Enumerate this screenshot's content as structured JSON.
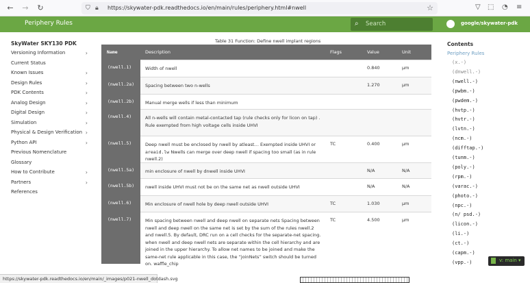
{
  "browser": {
    "url": "https://skywater-pdk.readthedocs.io/en/main/rules/periphery.html#nwell"
  },
  "header": {
    "title": "Periphery Rules",
    "search_placeholder": "Search",
    "repo_link": "google/skywater-pdk"
  },
  "left_nav": {
    "title": "SkyWater SKY130 PDK",
    "items": [
      {
        "label": "Versioning Information",
        "expandable": true
      },
      {
        "label": "Current Status",
        "expandable": false
      },
      {
        "label": "Known Issues",
        "expandable": true
      },
      {
        "label": "Design Rules",
        "expandable": true
      },
      {
        "label": "PDK Contents",
        "expandable": true
      },
      {
        "label": "Analog Design",
        "expandable": true
      },
      {
        "label": "Digital Design",
        "expandable": true
      },
      {
        "label": "Simulation",
        "expandable": true
      },
      {
        "label": "Physical & Design Verification",
        "expandable": true
      },
      {
        "label": "Python API",
        "expandable": true
      },
      {
        "label": "Previous Nomenclature",
        "expandable": false
      },
      {
        "label": "Glossary",
        "expandable": false
      },
      {
        "label": "How to Contribute",
        "expandable": true
      },
      {
        "label": "Partners",
        "expandable": true
      },
      {
        "label": "References",
        "expandable": false
      }
    ]
  },
  "table": {
    "caption": "Table 31 Function: Define nwell implant regions",
    "headers": {
      "name": "Name",
      "description": "Description",
      "flags": "Flags",
      "value": "Value",
      "unit": "Unit"
    },
    "rows": [
      {
        "name": "(nwell.1)",
        "desc": "Width of nwell",
        "desc_mono": "",
        "desc_after": "",
        "flags": "",
        "value": "0.840",
        "unit": "µm"
      },
      {
        "name": "(nwell.2a)",
        "desc": "Spacing between two n-wells",
        "desc_mono": "",
        "desc_after": "",
        "flags": "",
        "value": "1.270",
        "unit": "µm"
      },
      {
        "name": "(nwell.2b)",
        "desc": "Manual merge wells if less than minimum",
        "desc_mono": "",
        "desc_after": "",
        "flags": "",
        "value": "",
        "unit": ""
      },
      {
        "name": "(nwell.4)",
        "desc": "All n-wells will contain metal-contacted tap (rule checks only for licon on tap) . Rule exempted from high voltage cells inside UHVI",
        "desc_mono": "",
        "desc_after": "",
        "flags": "",
        "value": "",
        "unit": ""
      },
      {
        "name": "(nwell.5)",
        "desc": "Deep nwell must be enclosed by nwell by atleast… Exempted inside UHVI or",
        "desc_mono": "areaid.lw",
        "desc_after": "Nwells can merge over deep nwell if spacing too small (as in rule nwell.2)",
        "flags": "TC",
        "value": "0.400",
        "unit": "µm"
      },
      {
        "name": "(nwell.5a)",
        "desc": "min enclosure of nwell by dnwell inside UHVI",
        "desc_mono": "",
        "desc_after": "",
        "flags": "",
        "value": "N/A",
        "unit": "N/A"
      },
      {
        "name": "(nwell.5b)",
        "desc": "nwell inside UHVI must not be on the same net as nwell outside UHVI",
        "desc_mono": "",
        "desc_after": "",
        "flags": "",
        "value": "N/A",
        "unit": "N/A"
      },
      {
        "name": "(nwell.6)",
        "desc": "Min enclosure of nwell hole by deep nwell outside UHVI",
        "desc_mono": "",
        "desc_after": "",
        "flags": "TC",
        "value": "1.030",
        "unit": "µm"
      },
      {
        "name": "(nwell.7)",
        "desc": "Min spacing between nwell and deep nwell on separate nets Spacing between nwell and deep nwell on the same net is set by the sum of the rules nwell.2 and nwell.5. By default, DRC run on a cell checks for the separate-net spacing. when nwell and deep nwell nets are separate within the cell hierarchy and are joined in the upper hierarchy. To allow net names to be joined and make the same-net rule applicable in this case, the “joinNets” switch should be turned on. waffle_chip",
        "desc_mono": "",
        "desc_after": "",
        "flags": "TC",
        "value": "4.500",
        "unit": "µm"
      }
    ]
  },
  "toc": {
    "title": "Contents",
    "subtitle": "Periphery Rules",
    "items": [
      {
        "label": "(x.-)",
        "muted": true
      },
      {
        "label": "(dnwell.-)",
        "muted": true
      },
      {
        "label": "(nwell.-)",
        "muted": false
      },
      {
        "label": "(pwbm.-)",
        "muted": false
      },
      {
        "label": "(pwdem.-)",
        "muted": false
      },
      {
        "label": "(hvtp.-)",
        "muted": false
      },
      {
        "label": "(hvtr.-)",
        "muted": false
      },
      {
        "label": "(lvtn.-)",
        "muted": false
      },
      {
        "label": "(ncm.-)",
        "muted": false
      },
      {
        "label": "(difftap.-)",
        "muted": false
      },
      {
        "label": "(tunm.-)",
        "muted": false
      },
      {
        "label": "(poly.-)",
        "muted": false
      },
      {
        "label": "(rpm.-)",
        "muted": false
      },
      {
        "label": "(varac.-)",
        "muted": false
      },
      {
        "label": "(photo.-)",
        "muted": false
      },
      {
        "label": "(npc.-)",
        "muted": false
      },
      {
        "label": "(n/ psd.-)",
        "muted": false
      },
      {
        "label": "(licon.-)",
        "muted": false
      },
      {
        "label": "(li.-)",
        "muted": false
      },
      {
        "label": "(ct.-)",
        "muted": false
      },
      {
        "label": "(capm.-)",
        "muted": false
      },
      {
        "label": "(vpp.-)",
        "muted": false
      }
    ]
  },
  "version_badge": {
    "label": "v: main ▾"
  },
  "status_bar": {
    "text": "https://skywater-pdk.readthedocs.io/en/main/_images/p021-nwell_dotdash.svg"
  },
  "colors": {
    "brand_green": "#6ba744",
    "table_dark": "#6d6d6d"
  }
}
